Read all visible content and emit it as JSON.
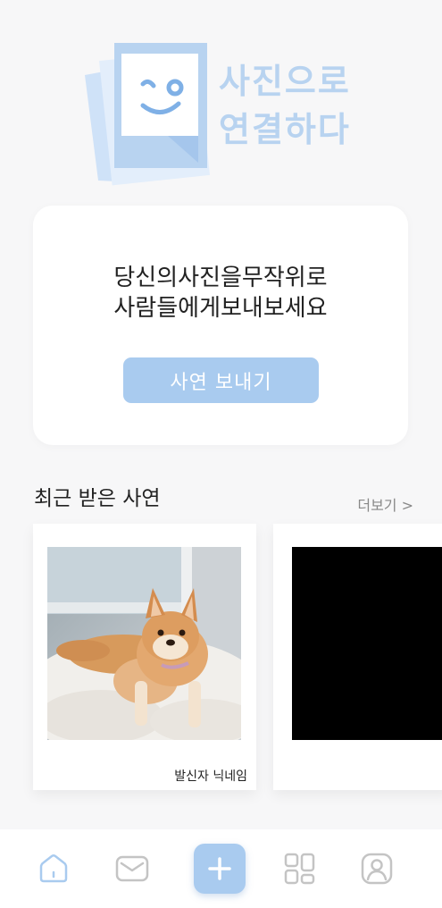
{
  "logo": {
    "line1": "사진으로",
    "line2": "연결하다",
    "color": "#b8d3f0"
  },
  "main_card": {
    "message_line1": "당신의사진을무작위로",
    "message_line2": "사람들에게보내보세요",
    "send_button_label": "사연 보내기",
    "accent": "#a9cbef"
  },
  "recent": {
    "title": "최근 받은 사연",
    "more_label": "더보기 >",
    "cards": [
      {
        "sender": "발신자 닉네임",
        "photo": "dog-photo"
      },
      {
        "sender": "",
        "photo": "black-photo"
      }
    ]
  },
  "nav": {
    "items": [
      {
        "icon": "home-icon",
        "active": true
      },
      {
        "icon": "mail-icon",
        "active": false
      },
      {
        "icon": "plus-icon",
        "active": false
      },
      {
        "icon": "grid-icon",
        "active": false
      },
      {
        "icon": "profile-icon",
        "active": false
      }
    ]
  }
}
